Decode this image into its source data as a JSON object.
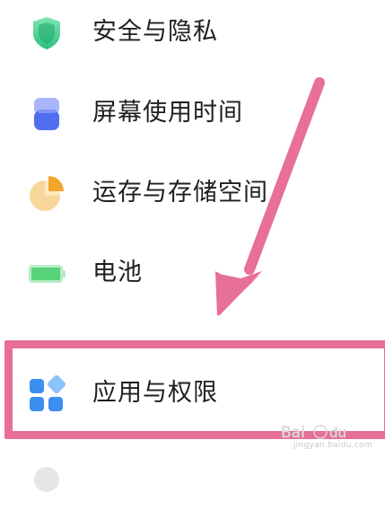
{
  "settings": {
    "items": [
      {
        "id": "security",
        "label": "安全与隐私",
        "icon": "shield-icon"
      },
      {
        "id": "screen_time",
        "label": "屏幕使用时间",
        "icon": "hourglass-icon"
      },
      {
        "id": "storage",
        "label": "运存与存储空间",
        "icon": "pie-chart-icon"
      },
      {
        "id": "battery",
        "label": "电池",
        "icon": "battery-icon"
      },
      {
        "id": "apps",
        "label": "应用与权限",
        "icon": "apps-grid-icon"
      }
    ]
  },
  "annotation": {
    "highlight_color": "#e76f98",
    "highlighted_item": "apps"
  },
  "watermark": {
    "text": "jingyan.baidu.com"
  },
  "colors": {
    "security_icon": "#3ecf8e",
    "screen_time_icon": "#5b7cf0",
    "storage_icon": "#f5b042",
    "battery_icon": "#57d27a",
    "apps_icon": "#3a8ff0"
  }
}
